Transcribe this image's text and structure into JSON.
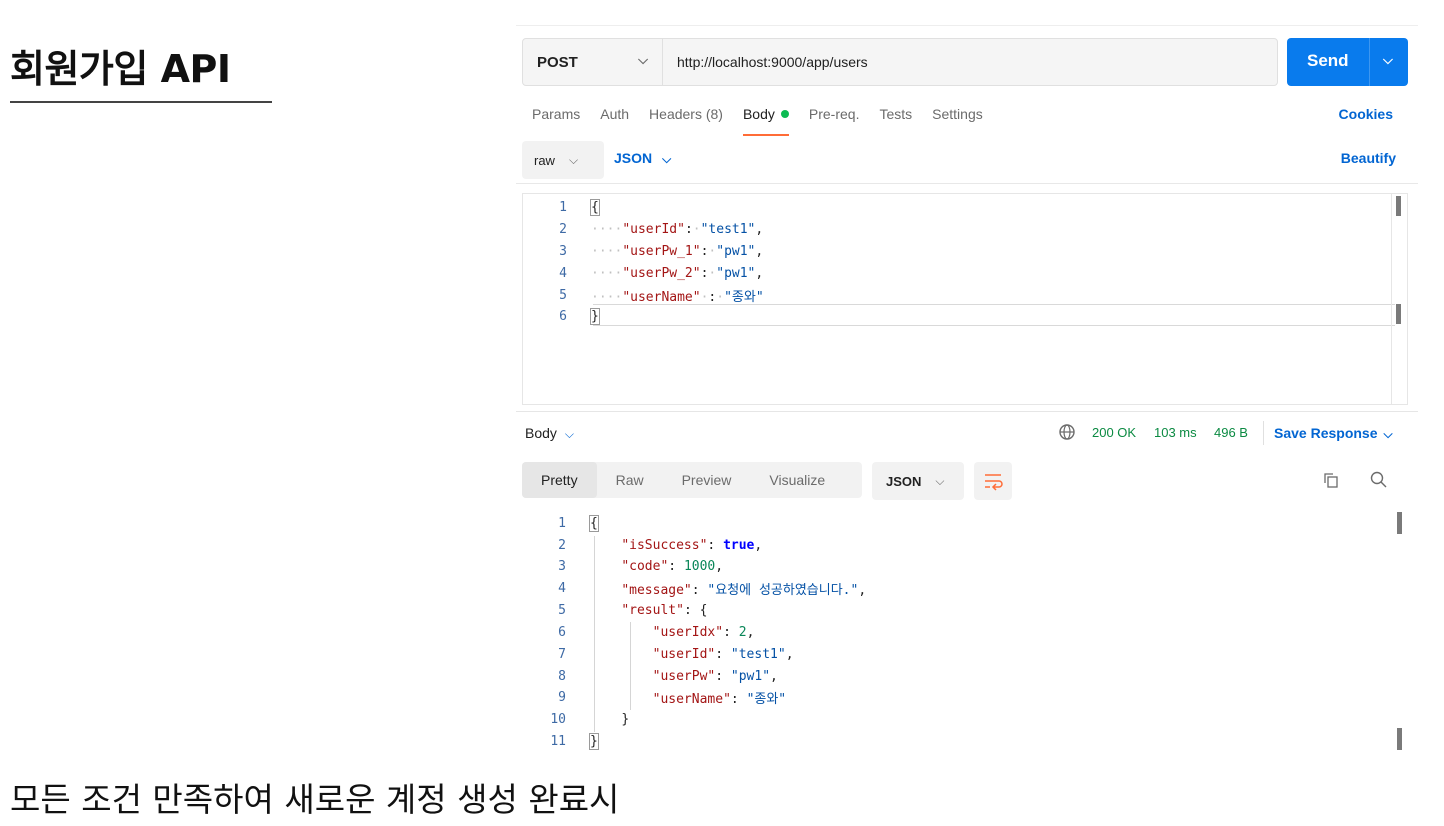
{
  "slide": {
    "title": "회원가입 API",
    "caption": "모든 조건 만족하여 새로운 계정 생성 완료시"
  },
  "request": {
    "method": "POST",
    "url": "http://localhost:9000/app/users",
    "send_label": "Send",
    "tabs": [
      {
        "label": "Params"
      },
      {
        "label": "Auth"
      },
      {
        "label": "Headers (8)"
      },
      {
        "label": "Body"
      },
      {
        "label": "Pre-req."
      },
      {
        "label": "Tests"
      },
      {
        "label": "Settings"
      }
    ],
    "active_tab": "Body",
    "cookies_label": "Cookies",
    "body_type": "raw",
    "body_language": "JSON",
    "beautify_label": "Beautify",
    "body_lines": [
      {
        "n": "1",
        "k": "",
        "v": ""
      },
      {
        "n": "2",
        "k": "\"userId\"",
        "v": "\"test1\""
      },
      {
        "n": "3",
        "k": "\"userPw_1\"",
        "v": "\"pw1\""
      },
      {
        "n": "4",
        "k": "\"userPw_2\"",
        "v": "\"pw1\""
      },
      {
        "n": "5",
        "k": "\"userName\"",
        "v": "\"종와\""
      },
      {
        "n": "6",
        "k": "",
        "v": ""
      }
    ]
  },
  "response": {
    "body_label": "Body",
    "status": "200 OK",
    "time": "103 ms",
    "size": "496 B",
    "save_label": "Save Response",
    "view_tabs": [
      "Pretty",
      "Raw",
      "Preview",
      "Visualize"
    ],
    "active_view": "Pretty",
    "format": "JSON",
    "lines": [
      {
        "n": "1"
      },
      {
        "n": "2",
        "k": "\"isSuccess\"",
        "v": "true",
        "t": "bool",
        "end": ","
      },
      {
        "n": "3",
        "k": "\"code\"",
        "v": "1000",
        "t": "num",
        "end": ","
      },
      {
        "n": "4",
        "k": "\"message\"",
        "v": "\"요청에 성공하였습니다.\"",
        "t": "str",
        "end": ","
      },
      {
        "n": "5",
        "k": "\"result\"",
        "v": "{",
        "t": "plain",
        "end": ""
      },
      {
        "n": "6",
        "k": "\"userIdx\"",
        "v": "2",
        "t": "num",
        "end": ","
      },
      {
        "n": "7",
        "k": "\"userId\"",
        "v": "\"test1\"",
        "t": "str",
        "end": ","
      },
      {
        "n": "8",
        "k": "\"userPw\"",
        "v": "\"pw1\"",
        "t": "str",
        "end": ","
      },
      {
        "n": "9",
        "k": "\"userName\"",
        "v": "\"종와\"",
        "t": "str",
        "end": ""
      },
      {
        "n": "10",
        "k": "",
        "v": "}",
        "t": "plain",
        "end": ""
      },
      {
        "n": "11"
      }
    ]
  }
}
